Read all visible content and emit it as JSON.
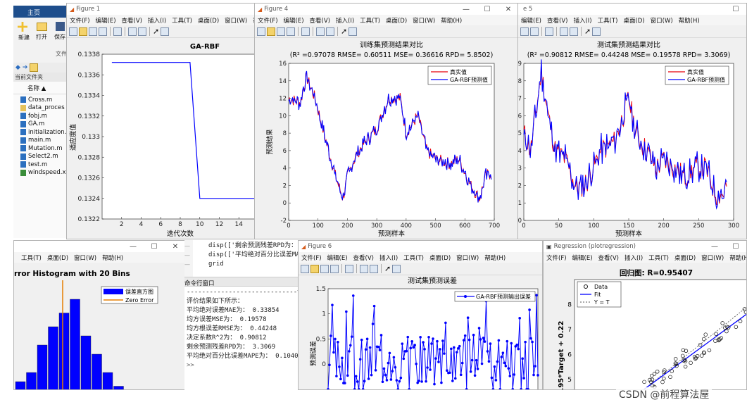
{
  "matlab": {
    "home_tab": "主页",
    "file_label": "文件",
    "new_label": "新建",
    "open_label": "打开",
    "save_label": "保存",
    "current_folder": "当前文件夹",
    "name_col": "名称 ▲",
    "files": [
      "Cross.m",
      "data_proces",
      "fobj.m",
      "GA.m",
      "initialization.",
      "main.m",
      "Mutation.m",
      "Select2.m",
      "test.m",
      "windspeed.x"
    ]
  },
  "fig1": {
    "title": "Figure 1",
    "menus": [
      "文件(F)",
      "编辑(E)",
      "查看(V)",
      "插入(I)",
      "工具(T)",
      "桌面(D)",
      "窗口(W)",
      "帮助"
    ]
  },
  "fig4": {
    "title": "Figure 4",
    "menus": [
      "文件(F)",
      "编辑(E)",
      "查看(V)",
      "插入(I)",
      "工具(T)",
      "桌面(D)",
      "窗口(W)",
      "帮助(H)"
    ]
  },
  "fig5": {
    "title": "e 5",
    "menus": [
      "编辑(E)",
      "查看(V)",
      "插入(I)",
      "工具(T)",
      "桌面(D)",
      "窗口(W)",
      "帮助(H)"
    ]
  },
  "fig6": {
    "title": "Figure 6",
    "menus": [
      "文件(F)",
      "编辑(E)",
      "查看(V)",
      "插入(I)",
      "工具(T)",
      "桌面(D)",
      "窗口(W)",
      "帮助(H)"
    ]
  },
  "figreg": {
    "title": "Regression (plotregression)",
    "menus": [
      "文件(F)",
      "编辑(E)",
      "查看(V)",
      "插入(I)",
      "工具(T)",
      "桌面(D)",
      "窗口(W)",
      "帮助(H)"
    ]
  },
  "fighist": {
    "menus": [
      "工具(T)",
      "桌面(D)",
      "窗口(W)",
      "帮助(H)"
    ]
  },
  "command": {
    "code": [
      "disp(['剩余预测残差RPD为：",
      "disp(['平均绝对百分比误差MA",
      "grid"
    ],
    "window_title": "命令行窗口",
    "lines": [
      "-----------------------------误差计算--",
      "评价结果如下所示：",
      "平均绝对误差MAE为：  0.33854",
      "均方误差MSE为：       0.19578",
      "均方根误差RMSE为：  0.44248",
      "决定系数R^2为：   0.90812",
      "剩余预测残差RPD为：    3.3069",
      "平均绝对百分比误差MAPE为：    0.1040"
    ],
    "prompt": ">>"
  },
  "watermark": "CSDN @前程算法屋",
  "colors": {
    "red": "#e8000b",
    "blue": "#0000ff",
    "orange": "#e67e00"
  },
  "chart_data": [
    {
      "type": "line",
      "title": "GA-RBF",
      "xlabel": "迭代次数",
      "ylabel": "适应度值",
      "xlim": [
        0,
        16
      ],
      "ylim": [
        0.1322,
        0.1338
      ],
      "xticks": [
        2,
        4,
        6,
        8,
        10,
        12,
        14
      ],
      "yticks": [
        0.1322,
        0.1324,
        0.1326,
        0.1328,
        0.133,
        0.1332,
        0.1334,
        0.1336,
        0.1338
      ],
      "x": [
        1,
        9,
        10,
        16
      ],
      "y": [
        0.13372,
        0.13372,
        0.1324,
        0.1324
      ]
    },
    {
      "type": "line",
      "title": "训练集预测结果对比",
      "subtitle": "(R² =0.97078 RMSE= 0.60511 MSE= 0.36616 RPD= 5.8502)",
      "xlabel": "预测样本",
      "ylabel": "预测结果",
      "xlim": [
        0,
        700
      ],
      "ylim": [
        -2,
        16
      ],
      "xticks": [
        0,
        100,
        200,
        300,
        400,
        500,
        600,
        700
      ],
      "yticks": [
        -2,
        0,
        2,
        4,
        6,
        8,
        10,
        12,
        14,
        16
      ],
      "series": [
        {
          "name": "真实值",
          "color": "#e8000b"
        },
        {
          "name": "GA-RBF预测值",
          "color": "#0000ff"
        }
      ],
      "anchors_x": [
        0,
        40,
        60,
        90,
        120,
        160,
        185,
        200,
        230,
        260,
        300,
        340,
        380,
        400,
        440,
        470,
        500,
        550,
        580,
        620,
        650,
        670,
        690
      ],
      "anchors_y": [
        12,
        11.5,
        14.5,
        12,
        8,
        3,
        0.5,
        3,
        5.5,
        7,
        8.5,
        12,
        12,
        8,
        10,
        6,
        5,
        4.5,
        5,
        2,
        0.5,
        3,
        3.5
      ]
    },
    {
      "type": "line",
      "title": "测试集预测结果对比",
      "subtitle": "(R² =0.90812 RMSE= 0.44248 MSE= 0.19578 RPD= 3.3069)",
      "xlabel": "预测样本",
      "ylabel": "",
      "xlim": [
        0,
        300
      ],
      "ylim": [
        0,
        9
      ],
      "xticks": [
        0,
        50,
        100,
        150,
        200,
        250,
        300
      ],
      "yticks": [
        0,
        1,
        2,
        3,
        4,
        5,
        6,
        7,
        8,
        9
      ],
      "series": [
        {
          "name": "真实值",
          "color": "#e8000b"
        },
        {
          "name": "GA-RBF预测值",
          "color": "#0000ff"
        }
      ],
      "anchors_x": [
        0,
        10,
        25,
        35,
        45,
        60,
        75,
        90,
        110,
        130,
        150,
        160,
        175,
        190,
        200,
        215,
        230,
        245,
        260,
        275,
        285,
        300
      ],
      "anchors_y": [
        5,
        4,
        8.5,
        6,
        4,
        3.5,
        1.8,
        2.2,
        4,
        4.5,
        7,
        5,
        4,
        3,
        3.5,
        3,
        2.5,
        3,
        3,
        1.5,
        1.5,
        3
      ]
    },
    {
      "type": "line",
      "title": "测试集预测误差",
      "xlabel": "",
      "ylabel": "预测误差",
      "xlim": [
        0,
        300
      ],
      "ylim": [
        -0.6,
        1.5
      ],
      "yticks": [
        0,
        0.5,
        1,
        1.5
      ],
      "series": [
        {
          "name": "GA-RBF预测输出误差",
          "color": "#0000ff"
        }
      ]
    },
    {
      "type": "bar",
      "title": "rror Histogram with 20 Bins",
      "series": [
        {
          "name": "误差直方图",
          "color": "#0000ff"
        },
        {
          "name": "Zero Error",
          "color": "#e67e00"
        }
      ],
      "values": [
        1,
        2,
        5,
        7,
        8.5,
        10,
        6,
        4,
        2,
        0.5
      ]
    },
    {
      "type": "scatter",
      "title": "回归图: R=0.95407",
      "ylabel": ".95*Target + 0.22",
      "ylim": [
        4.5,
        9
      ],
      "yticks": [
        5,
        6,
        7,
        8
      ],
      "series": [
        {
          "name": "Data"
        },
        {
          "name": "Fit"
        },
        {
          "name": "Y = T"
        }
      ]
    }
  ]
}
